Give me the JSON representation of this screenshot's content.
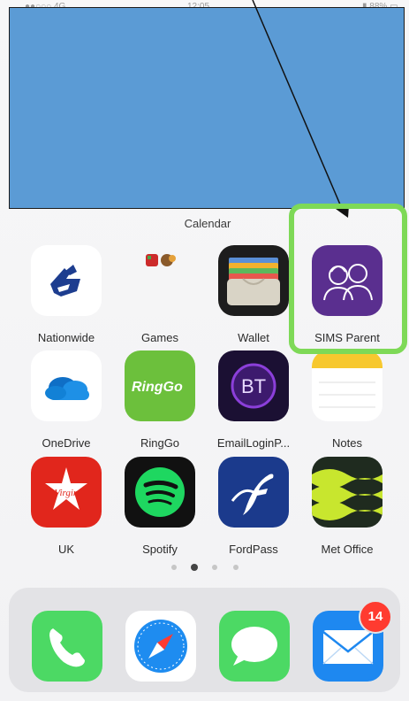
{
  "status_bar": {
    "signal": "●●○○○ 4G",
    "time": "12:05",
    "battery": "▮ 88% ▭"
  },
  "folder_label": "Calendar",
  "apps": [
    {
      "name": "Nationwide",
      "icon": "nationwide-icon"
    },
    {
      "name": "Games",
      "icon": "games-folder-icon"
    },
    {
      "name": "Wallet",
      "icon": "wallet-icon"
    },
    {
      "name": "SIMS Parent",
      "icon": "sims-parent-icon"
    },
    {
      "name": "OneDrive",
      "icon": "onedrive-icon"
    },
    {
      "name": "RingGo",
      "icon": "ringgo-icon"
    },
    {
      "name": "EmailLoginP...",
      "icon": "bt-email-icon"
    },
    {
      "name": "Notes",
      "icon": "notes-icon"
    },
    {
      "name": "UK",
      "icon": "virgin-uk-icon"
    },
    {
      "name": "Spotify",
      "icon": "spotify-icon"
    },
    {
      "name": "FordPass",
      "icon": "fordpass-icon"
    },
    {
      "name": "Met Office",
      "icon": "met-office-icon"
    }
  ],
  "icon_text": {
    "ringgo": "RingGo",
    "bt": "BT",
    "virgin": "Virgin"
  },
  "page_dots": {
    "count": 4,
    "active": 2
  },
  "dock": [
    {
      "name": "Phone",
      "icon": "phone-icon"
    },
    {
      "name": "Safari",
      "icon": "safari-icon"
    },
    {
      "name": "Messages",
      "icon": "messages-icon"
    },
    {
      "name": "Mail",
      "icon": "mail-icon",
      "badge": "14"
    }
  ],
  "annotation": {
    "highlight_color": "#7ed957",
    "overlay_color": "#5b9bd5"
  }
}
